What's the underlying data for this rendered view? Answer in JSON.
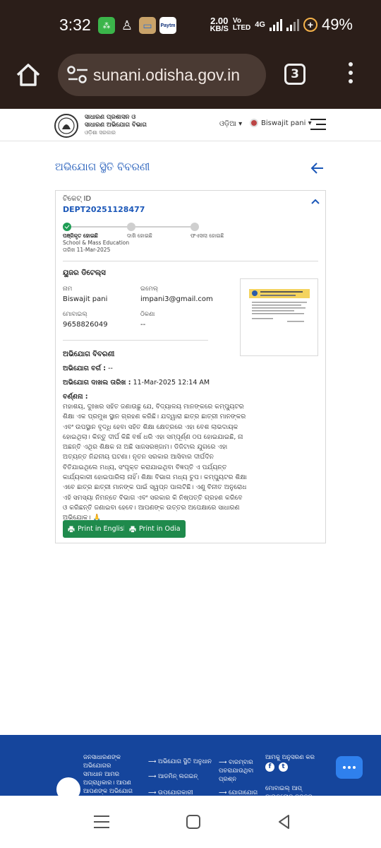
{
  "status_bar": {
    "time": "3:32",
    "net_speed": "2.00",
    "net_unit": "KB/S",
    "lte_top": "Vo",
    "lte_bottom": "LTED",
    "network": "4G",
    "battery": "49%",
    "app_icons": [
      "chat-app-icon",
      "profile-app-icon",
      "amazon-app-icon",
      "paytm-app-icon"
    ],
    "paytm_label": "Paytm"
  },
  "browser": {
    "url": "sunani.odisha.gov.in",
    "tab_count": "3"
  },
  "site_header": {
    "org_line1": "ସାଧାରଣ ପ୍ରଶାସନ ଓ",
    "org_line2": "ସାଧାରଣ ଅଭିଯୋଗ ବିଭାଗ",
    "org_line3": "ଓଡ଼ିଶା ସରକାର",
    "language": "ଓଡ଼ିଆ ▾",
    "user_name": "Biswajit pani ▾"
  },
  "page": {
    "title": "ଅଭିଯୋଗ ସ୍ଥିତି ବିବରଣୀ"
  },
  "ticket": {
    "label": "ଟିକେଟ୍ ID",
    "id": "DEPT20251128477",
    "steps": [
      {
        "label": "ପଞ୍ଜିକୃତ ହୋଇଛି",
        "dept": "School & Mass Education",
        "date": "ତାରିଖ 11-Mar-2025",
        "done": true
      },
      {
        "label": "ଦାଖି ହୋଇଛି",
        "dept": "",
        "date": "",
        "done": false
      },
      {
        "label": "ଫଏସଲା ହୋଇଛି",
        "dept": "",
        "date": "",
        "done": false
      }
    ]
  },
  "user_details": {
    "heading": "ୟୁଜର ଡିଟେଲ୍ସ",
    "name_label": "ନାମ",
    "name_value": "Biswajit pani",
    "email_label": "ଇମେଲ୍",
    "email_value": "impani3@gmail.com",
    "mobile_label": "ମୋବାଇଲ୍",
    "mobile_value": "9658826049",
    "address_label": "ଠିକଣା",
    "address_value": "--"
  },
  "grievance": {
    "heading": "ଅଭିଯୋଗ ବିବରଣୀ",
    "category_label": "ଅଭିଯୋଗ ବର୍ଗ :",
    "category_value": "--",
    "date_label": "ଅଭିଯୋଗ ଦାଖଲ ତାରିଖ :",
    "date_value": "11-Mar-2025 12:14 AM",
    "desc_label": "ବର୍ଣ୍ଣନା :",
    "desc_text": "ମହାଶୟ, ଦୁଃଖର ସହିତ ଜଣାଉଛୁ ଯେ, ବିଦ୍ୟାଳୟ ମାନଙ୍କରେ କମ୍ପ୍ୟୁଟର ଶିକ୍ଷା ଏକ ପ୍ରମୁଖ ସ୍ଥାନ ଗ୍ରହଣ କରିଛି। ଯଦ୍ୱାରା ଛାତ୍ର ଛାତ୍ରୀ ମାନଙ୍କର ଏବଂ ଉପସ୍ଥାନ ବୃଦ୍ଧି ହେବା ସହିତ ଶିକ୍ଷା କ୍ଷେତ୍ରରେ ଏହା ବେଶ ଲାଭଦାୟକ ହୋଇଥିଲା। କିନ୍ତୁ ଦୀର୍ଘ କିଛି ବର୍ଷ ଧରି ଏହା ସମ୍ପୂର୍ଣ୍ଣ ଠପ ହୋଇଯାଇଛି, ନା ଅଛନ୍ତି ଏଥିର ଶିକ୍ଷକ ନା ଅଛି ସାଜସରଞ୍ଜାମ। ଡିଜିଟାଲ ଯୁଗରେ ଏହା ଅତ୍ୟନ୍ତ ନିନ୍ଦନୀୟ ଘଟଣା। ନୂତନ ସରକାର ଆସିବାର ଦୀର୍ଘଦିନ ବିତିଯାଇଥିଲେ ମଧ୍ୟ, ସଂପୃକ୍ତ କରାଯାଇଥିବା ବିଜ୍ଞପ୍ତି ଏ ପର୍ଯ୍ୟନ୍ତ କାର୍ଯ୍ୟକାରୀ ହୋଇପାରିଲା ନାହିଁ। ଶିକ୍ଷା ବିଭାଗ ମଧ୍ୟ ଚୁପ। କମ୍ପ୍ୟୁଟର ଶିକ୍ଷା ଏବେ ଛାତ୍ର ଛାତ୍ରୀ ମାନଙ୍କ ପାଇଁ ସ୍ୱପ୍ନ ପାଲଟିଛି। ଏଣୁ ବିନୀତ ଅନୁରୋଧ ଏହି ସମସ୍ୟା ନିମନ୍ତେ ବିଭାଗ ଏବଂ ସରକାର କି ନିଷ୍ପତ୍ତି ଗ୍ରହଣ କରିବେ ଓ କରିଛନ୍ତି ଜଣାଇବା ହେବେ। ଆପଣଙ୍କ ଉତ୍ତର ଅପେକ୍ଷାରେ ସାଧାରଣ ଅଭିଯୋକ। 🙏",
    "print_english": "Print in English",
    "print_odia": "Print in Odia"
  },
  "footer": {
    "tagline": [
      "ଜନସାଧାରଣଙ୍କ",
      "ଅଭିଯୋଗର",
      "ସମାଧାନ ଆମର",
      "ଅଗ୍ରାଧିକାର। ଆପଣ",
      "ଆପଣଙ୍କ ଅଭିଯୋଗ"
    ],
    "links_col1": [
      "ଅଭିଯୋଗ ସ୍ଥିତି ଅନୁଧାନ",
      "ଆଡମିନ୍ ଲଗଇନ୍",
      "ଉପଯୋଗକାରୀ"
    ],
    "links_col2": [
      "ବାରମ୍ବାର ପଚରାଯାଉଥିବା ପ୍ରଶ୍ନ",
      "ଯୋଗାଯୋଗ"
    ],
    "follow_us": "ଆମକୁ ଅନୁସରଣ କର",
    "app_download": "ମୋବାଇଲ୍ ଆପ୍ ଡାଉନଲୋଡ୍ କରନ୍ତୁ"
  },
  "colors": {
    "accent_blue": "#1b57b8",
    "success_green": "#1f8a4c",
    "footer_blue": "#15459c",
    "browser_chrome": "#2b1e19"
  }
}
